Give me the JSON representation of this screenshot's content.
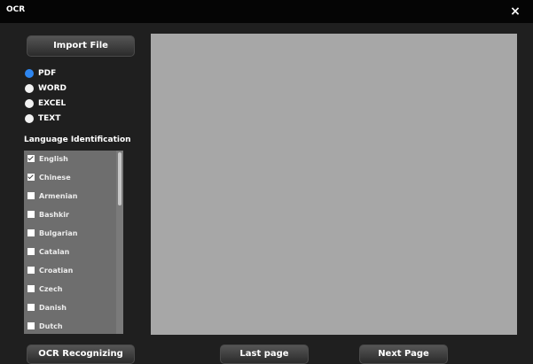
{
  "window": {
    "title": "OCR",
    "close_glyph": "×"
  },
  "sidebar": {
    "import_label": "Import File",
    "formats": [
      {
        "label": "PDF",
        "selected": true
      },
      {
        "label": "WORD",
        "selected": false
      },
      {
        "label": "EXCEL",
        "selected": false
      },
      {
        "label": "TEXT",
        "selected": false
      }
    ],
    "language_title": "Language Identification",
    "languages": [
      {
        "label": "English",
        "checked": true
      },
      {
        "label": "Chinese",
        "checked": true
      },
      {
        "label": "Armenian",
        "checked": false
      },
      {
        "label": "Bashkir",
        "checked": false
      },
      {
        "label": "Bulgarian",
        "checked": false
      },
      {
        "label": "Catalan",
        "checked": false
      },
      {
        "label": "Croatian",
        "checked": false
      },
      {
        "label": "Czech",
        "checked": false
      },
      {
        "label": "Danish",
        "checked": false
      },
      {
        "label": "Dutch",
        "checked": false
      }
    ]
  },
  "footer": {
    "ocr_label": "OCR Recognizing",
    "last_label": "Last page",
    "next_label": "Next Page"
  },
  "colors": {
    "window_bg": "#1f1f1f",
    "titlebar_bg": "#050505",
    "preview_bg": "#a7a7a7",
    "list_bg": "#6e6e6e",
    "accent_radio": "#2e86f0"
  }
}
